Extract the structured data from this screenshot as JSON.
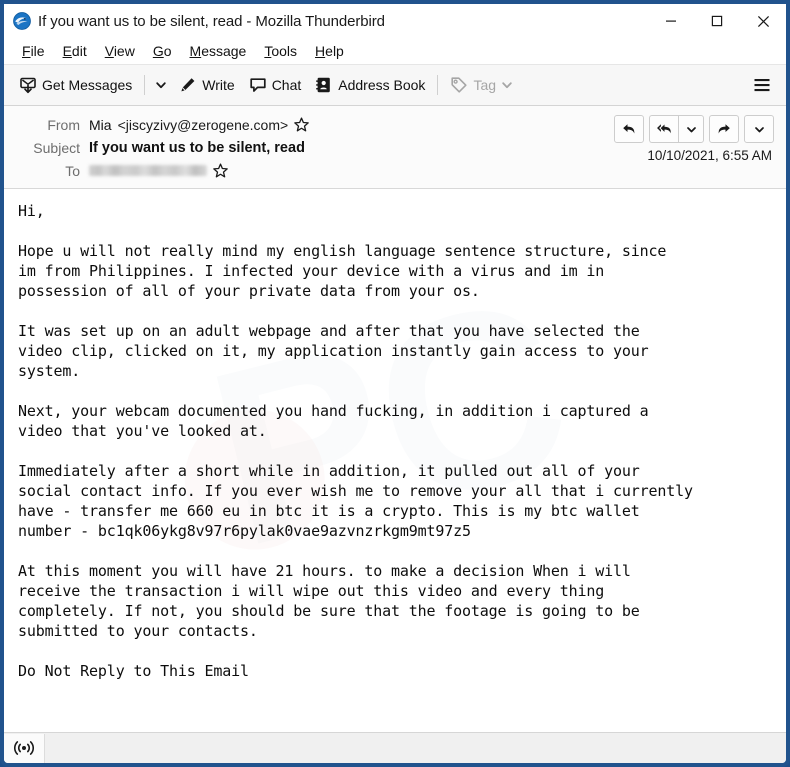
{
  "window": {
    "title": "If you want us to be silent, read - Mozilla Thunderbird",
    "app_logo_icon": "thunderbird-logo-icon",
    "controls": {
      "minimize": "minimize-icon",
      "maximize": "maximize-icon",
      "close": "close-icon"
    }
  },
  "menu_bar": {
    "items": [
      {
        "label": "File",
        "accel": "F"
      },
      {
        "label": "Edit",
        "accel": "E"
      },
      {
        "label": "View",
        "accel": "V"
      },
      {
        "label": "Go",
        "accel": "G"
      },
      {
        "label": "Message",
        "accel": "M"
      },
      {
        "label": "Tools",
        "accel": "T"
      },
      {
        "label": "Help",
        "accel": "H"
      }
    ]
  },
  "toolbar": {
    "get_messages_label": "Get Messages",
    "get_messages_icon": "download-mail-icon",
    "get_messages_caret_icon": "chevron-down-icon",
    "write_label": "Write",
    "write_icon": "pencil-icon",
    "chat_label": "Chat",
    "chat_icon": "speech-bubble-icon",
    "address_book_label": "Address Book",
    "address_book_icon": "address-book-icon",
    "tag_label": "Tag",
    "tag_icon": "tag-icon",
    "tag_caret_icon": "chevron-down-icon",
    "tag_disabled": true,
    "app_menu_icon": "hamburger-menu-icon"
  },
  "message_header": {
    "from_label": "From",
    "from_name": "Mia",
    "from_address": "<jiscyzivy@zerogene.com>",
    "from_star_icon": "star-icon",
    "subject_label": "Subject",
    "subject_value": "If you want us to be silent, read",
    "to_label": "To",
    "to_value": "",
    "to_redacted": true,
    "to_star_icon": "star-icon",
    "date": "10/10/2021, 6:55 AM",
    "actions": [
      {
        "name": "reply-button",
        "icon": "reply-arrow-icon"
      },
      {
        "name": "reply-all-button",
        "icon": "reply-all-arrow-icon"
      },
      {
        "name": "reply-all-dropdown",
        "icon": "chevron-down-icon"
      },
      {
        "name": "forward-button",
        "icon": "forward-arrow-icon"
      },
      {
        "name": "more-actions-dropdown",
        "icon": "chevron-down-icon"
      }
    ]
  },
  "message_body": {
    "text": "Hi,\n\nHope u will not really mind my english language sentence structure, since\nim from Philippines. I infected your device with a virus and im in\npossession of all of your private data from your os.\n\nIt was set up on an adult webpage and after that you have selected the\nvideo clip, clicked on it, my application instantly gain access to your\nsystem.\n\nNext, your webcam documented you hand fucking, in addition i captured a\nvideo that you've looked at.\n\nImmediately after a short while in addition, it pulled out all of your\nsocial contact info. If you ever wish me to remove your all that i currently\nhave - transfer me 660 eu in btc it is a crypto. This is my btc wallet\nnumber - bc1qk06ykg8v97r6pylak0vae9azvnzrkgm9mt97z5\n\nAt this moment you will have 21 hours. to make a decision When i will\nreceive the transaction i will wipe out this video and every thing\ncompletely. If not, you should be sure that the footage is going to be\nsubmitted to your contacts.\n\nDo Not Reply to This Email",
    "btc_wallet": "bc1qk06ykg8v97r6pylak0vae9azvnzrkgm9mt97z5",
    "ransom_amount": "660 eu",
    "deadline": "21 hours"
  },
  "status_bar": {
    "icon": "broadcast-antenna-icon",
    "text": ""
  },
  "colors": {
    "window_border": "#21538d",
    "toolbar_bg": "#f7f7f7",
    "header_bg": "#fbfbfb",
    "body_bg": "#ffffff",
    "text": "#0d0d0d",
    "label_muted": "#6e6e6e",
    "disabled": "#a6a6a6"
  }
}
